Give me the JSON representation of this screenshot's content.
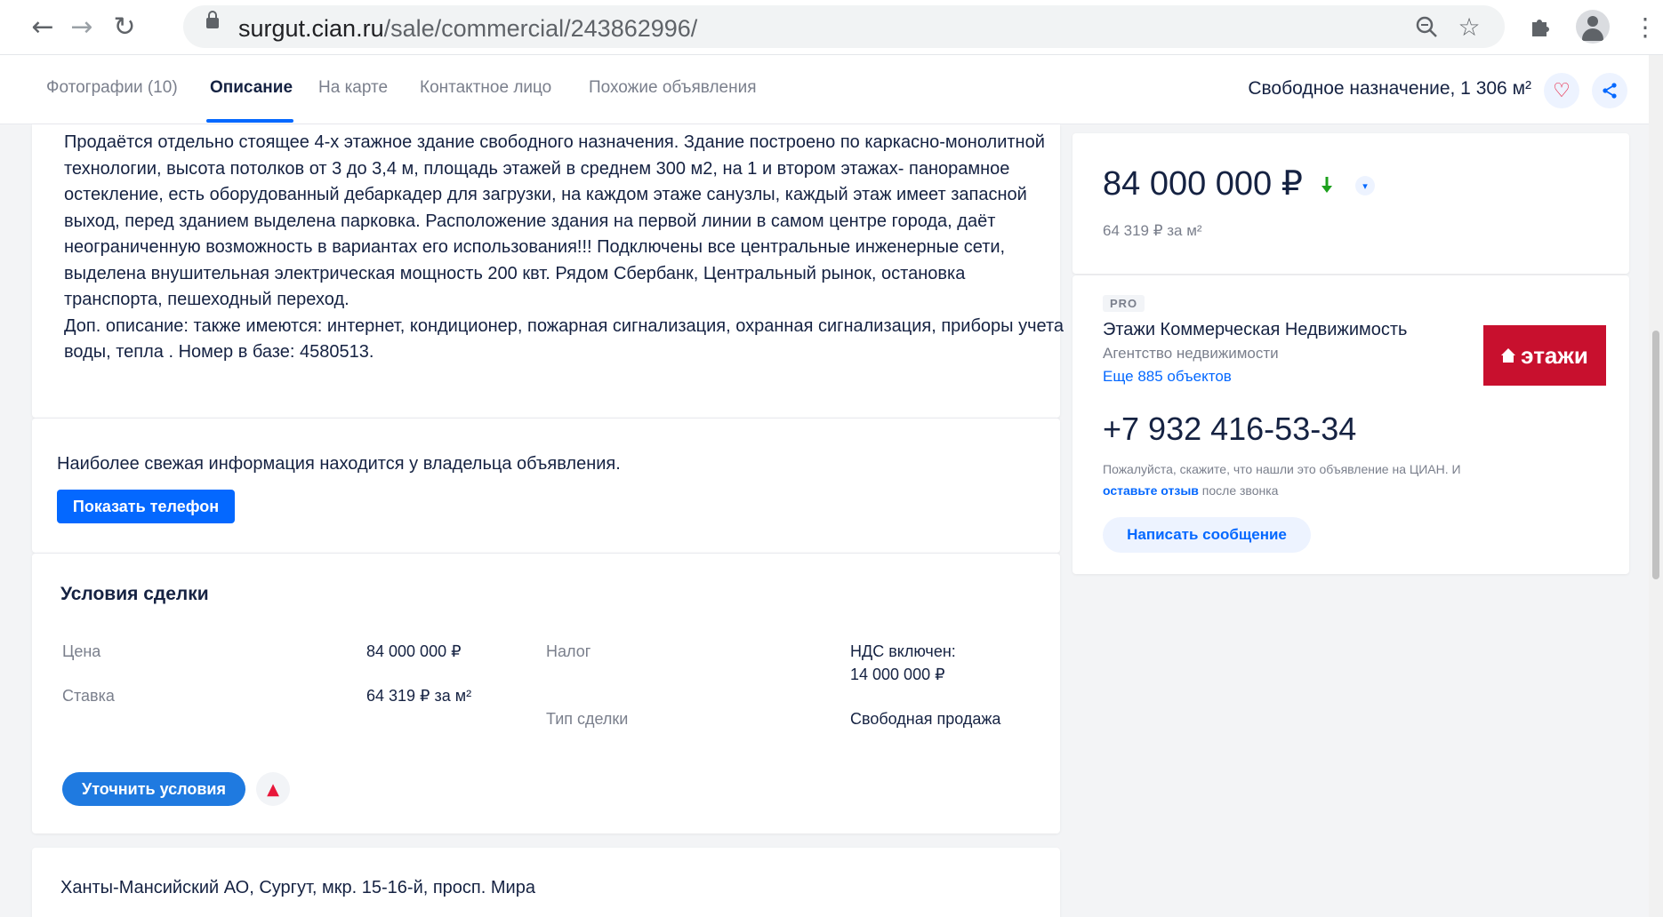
{
  "browser": {
    "url_host": "surgut.cian.ru",
    "url_path": "/sale/commercial/243862996/"
  },
  "tabs": [
    {
      "label": "Фотографии (10)"
    },
    {
      "label": "Описание"
    },
    {
      "label": "На карте"
    },
    {
      "label": "Контактное лицо"
    },
    {
      "label": "Похожие объявления"
    }
  ],
  "header_summary": "Свободное назначение, 1 306 м²",
  "description": {
    "main": "Продаётся отдельно стоящее 4-х этажное здание свободного назначения. Здание построено по каркасно-монолитной технологии, высота потолков от 3 до 3,4 м, площадь этажей в среднем 300 м2, на 1 и втором этажах- панорамное остекление, есть оборудованный дебаркадер для загрузки, на каждом этаже санузлы, каждый этаж имеет запасной выход, перед зданием выделена парковка. Расположение здания на первой линии в самом центре города, даёт неограниченную возможность в вариантах его использования!!! Подключены все центральные инженерные сети, выделена внушительная электрическая мощность 200 квт. Рядом Сбербанк, Центральный рынок, остановка транспорта, пешеходный переход.",
    "extra": " Доп. описание: также имеются: интернет, кондиционер, пожарная сигнализация, охранная сигнализация, приборы учета воды, тепла . Номер в базе: 4580513."
  },
  "owner_info": {
    "text": "Наиболее свежая информация находится у владельца объявления.",
    "show_phone_label": "Показать телефон"
  },
  "deal": {
    "title": "Условия сделки",
    "price_label": "Цена",
    "price_value": "84 000 000 ₽",
    "rate_label": "Ставка",
    "rate_value": "64 319 ₽ за м²",
    "tax_label": "Налог",
    "tax_value_line1": "НДС включен:",
    "tax_value_line2": "14 000 000 ₽",
    "type_label": "Тип сделки",
    "type_value": "Свободная продажа",
    "clarify_label": "Уточнить условия"
  },
  "address": "Ханты-Мансийский АО, Сургут, мкр. 15-16-й, просп. Мира",
  "price_card": {
    "price": "84 000 000 ₽",
    "per_meter": "64 319 ₽ за м²"
  },
  "agent": {
    "badge": "PRO",
    "name": "Этажи Коммерческая Недвижимость",
    "type": "Агентство недвижимости",
    "more_link": "Еще 885 объектов",
    "logo_text": "этажи",
    "phone": "+7 932 416-53-34",
    "note_before": "Пожалуйста, скажите, что нашли это объявление на ЦИАН. И ",
    "note_link": "оставьте отзыв",
    "note_after": " после звонка",
    "message_label": "Написать сообщение"
  },
  "colors": {
    "accent": "#0468ff",
    "price_down": "#1da01d",
    "logo_bg": "#c8102e",
    "heart": "#e8173a"
  }
}
